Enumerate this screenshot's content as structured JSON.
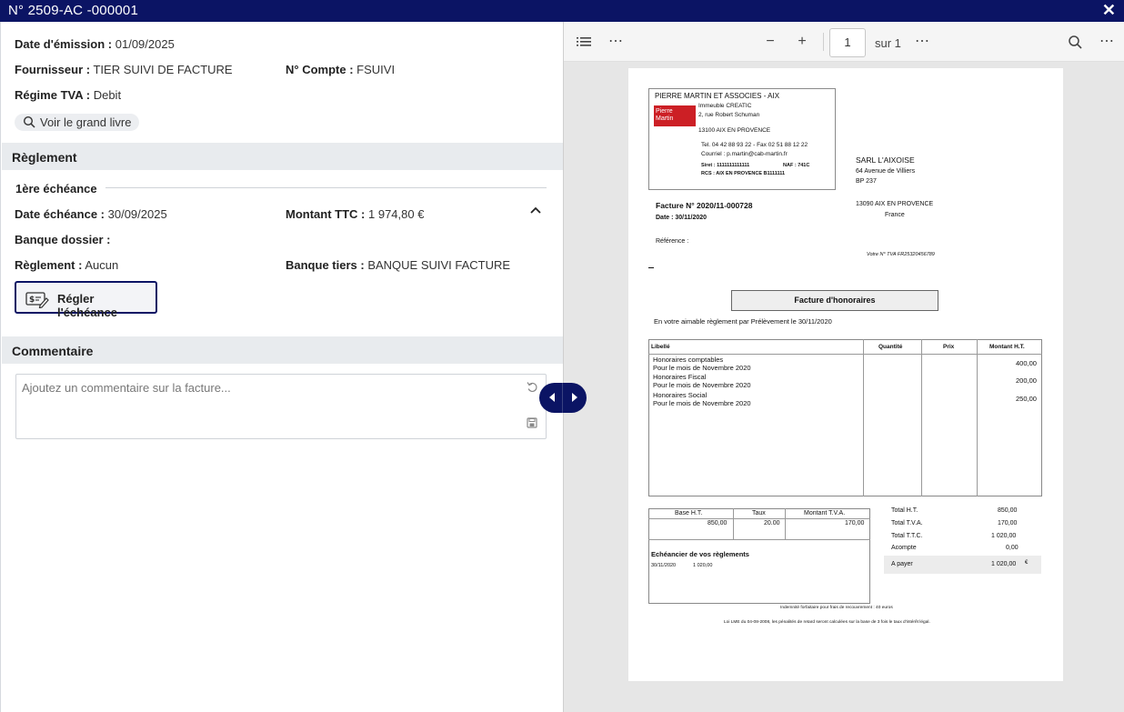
{
  "window": {
    "title": "N° 2509-AC -000001"
  },
  "invoice": {
    "emission_label": "Date d'émission :",
    "emission_value": "01/09/2025",
    "supplier_label": "Fournisseur :",
    "supplier_value": "TIER SUIVI DE FACTURE",
    "account_label": "N° Compte :",
    "account_value": "FSUIVI",
    "vat_label": "Régime TVA :",
    "vat_value": "Debit",
    "ledger_button": "Voir le grand livre"
  },
  "reglement": {
    "section_title": "Règlement",
    "subhead": "1ère échéance",
    "due_label": "Date échéance :",
    "due_value": "30/09/2025",
    "amount_label": "Montant TTC :",
    "amount_value": "1 974,80 €",
    "bank_label": "Banque dossier :",
    "bank_value": "",
    "mode_label": "Règlement :",
    "mode_value": "Aucun",
    "third_bank_label": "Banque tiers :",
    "third_bank_value": "BANQUE SUIVI FACTURE",
    "pay_button": "Régler l'échéance"
  },
  "comment": {
    "section_title": "Commentaire",
    "placeholder": "Ajoutez un commentaire sur la facture..."
  },
  "viewer": {
    "page_number": "1",
    "page_of": "sur 1"
  },
  "document": {
    "firm_name": "PIERRE MARTIN ET ASSOCIES - AIX",
    "logo_line1": "Pierre",
    "logo_line2": "Martin",
    "addr1": "Immeuble CREATIC",
    "addr2": "2, rue Robert Schuman",
    "addr3": "13100 AIX EN PROVENCE",
    "tel": "Tel.   04 42 88 93 22     - Fax  02 51 88 12 22",
    "mail": "Courriel : p.martin@cab-martin.fr",
    "siret": "Siret : 1111111111111",
    "naf": "NAF : 741C",
    "rcs": "RCS : AIX EN PROVENCE B1111111",
    "client_name": "SARL L'AIXOISE",
    "client_addr1": "64 Avenue de Villiers",
    "client_addr2": "BP 237",
    "client_city": "13090 AIX EN PROVENCE",
    "client_country": "France",
    "invoice_no": "Facture N° 2020/11-000728",
    "invoice_date": "Date : 30/11/2020",
    "reference": "Référence :",
    "vat_no": "Votre N° TVA FR25320456789",
    "doc_title": "Facture d'honoraires",
    "intro": "En votre aimable règlement par Prélèvement le 30/11/2020",
    "col_label": "Libellé",
    "col_qty": "Quantité",
    "col_price": "Prix",
    "col_amount": "Montant H.T.",
    "lines": [
      {
        "l1": "Honoraires comptables",
        "l2": "Pour le mois de Novembre 2020",
        "amount": "400,00"
      },
      {
        "l1": "Honoraires Fiscal",
        "l2": "Pour le mois de Novembre 2020",
        "amount": "200,00"
      },
      {
        "l1": "Honoraires Social",
        "l2": "Pour le mois de Novembre 2020",
        "amount": "250,00"
      }
    ],
    "tax_base_h": "Base H.T.",
    "tax_rate_h": "Taux",
    "tax_amt_h": "Montant T.V.A.",
    "tax_base": "850,00",
    "tax_rate": "20.00",
    "tax_amt": "170,00",
    "schedule_title": "Echéancier de vos règlements",
    "schedule_date": "30/11/2020",
    "schedule_amount": "1 020,00",
    "total_ht_label": "Total H.T.",
    "total_ht": "850,00",
    "total_tva_label": "Total T.V.A.",
    "total_tva": "170,00",
    "total_ttc_label": "Total T.T.C.",
    "total_ttc": "1 020,00",
    "deposit_label": "Acompte",
    "deposit": "0,00",
    "topay_label": "A payer",
    "topay": "1 020,00",
    "currency": "€",
    "footer1": "Indemnité forfaitaire pour frais de recouvrement : 40 euros",
    "footer2": "Loi LME du 04-08-2008, les pénalités de retard seront calculées sur la base de 3 fois le taux d'intérêt légal."
  },
  "colors": {
    "brand_navy": "#0b1464",
    "section_bg": "#e8ebee",
    "logo_red": "#cc1f25"
  }
}
